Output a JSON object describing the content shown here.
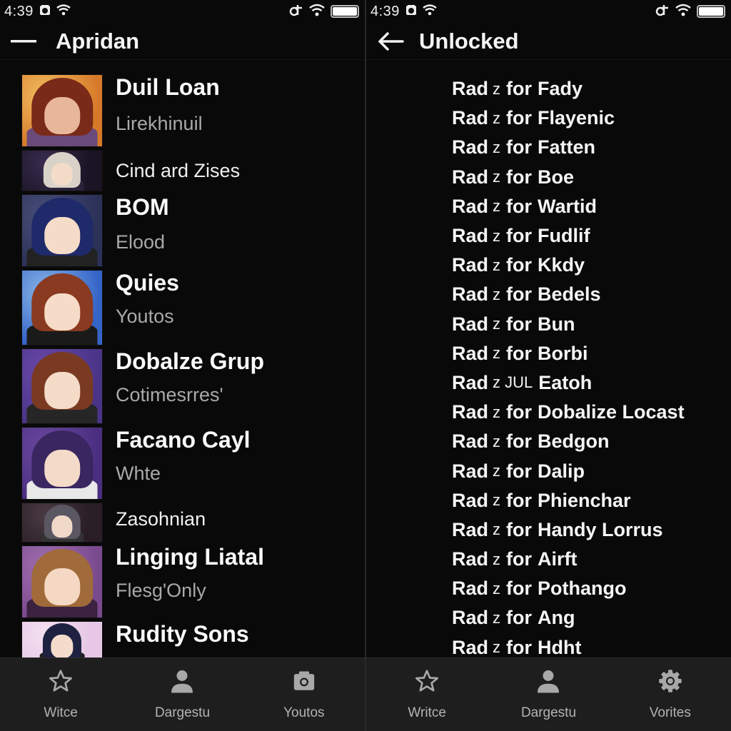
{
  "left_panel": {
    "status_bar": {
      "time": "4:39",
      "icons": [
        "alarm-icon",
        "wifi-icon",
        "vibrate-icon",
        "wifi-signal-icon",
        "battery-icon"
      ]
    },
    "app_bar": {
      "nav_icon": "menu-icon",
      "title": "Apridan"
    },
    "characters": [
      {
        "name": "Duil Loan",
        "subtitle": "Lirekhinuil",
        "palette": {
          "bg": "#d67a2a",
          "bg2": "#f3c060",
          "hair": "#7a2a18",
          "skin": "#e8b79a",
          "body": "#6a4a7a"
        }
      },
      {
        "name": "Cind ard Zises",
        "subtitle": "",
        "palette": {
          "bg": "#1a1424",
          "bg2": "#3a2c50",
          "hair": "#d8d2c8",
          "skin": "#f2dcc8",
          "body": "#2a2238"
        }
      },
      {
        "name": "BOM",
        "subtitle": "Elood",
        "palette": {
          "bg": "#2c3158",
          "bg2": "#4a4f7a",
          "hair": "#1f2a6a",
          "skin": "#f5dcc8",
          "body": "#222"
        }
      },
      {
        "name": "Quies",
        "subtitle": "Youtos",
        "palette": {
          "bg": "#3564c8",
          "bg2": "#8ab8e8",
          "hair": "#8a3a20",
          "skin": "#f6dcc8",
          "body": "#1a1a1a"
        }
      },
      {
        "name": "Dobalze Grup",
        "subtitle": "Cotimesrres'",
        "palette": {
          "bg": "#4a3488",
          "bg2": "#6a4aa8",
          "hair": "#7a3a22",
          "skin": "#f4dcc8",
          "body": "#262626"
        }
      },
      {
        "name": "Facano Cayl",
        "subtitle": "Whte",
        "palette": {
          "bg": "#4a2e80",
          "bg2": "#6a4aa0",
          "hair": "#3a2660",
          "skin": "#f4dac8",
          "body": "#e8e8e8"
        }
      },
      {
        "name": "Zasohnian",
        "subtitle": "",
        "palette": {
          "bg": "#2a1e26",
          "bg2": "#4a3a44",
          "hair": "#5a5662",
          "skin": "#f0d8c8",
          "body": "#333"
        }
      },
      {
        "name": "Linging Liatal",
        "subtitle": "Flesg'Only",
        "palette": {
          "bg": "#7a4a8e",
          "bg2": "#a070b0",
          "hair": "#a06a3a",
          "skin": "#f4d8c4",
          "body": "#3a2240"
        }
      },
      {
        "name": "Rudity Sons",
        "subtitle": "",
        "palette": {
          "bg": "#e6c8e6",
          "bg2": "#f4e0f0",
          "hair": "#1e2240",
          "skin": "#f4dccc",
          "body": "#222"
        }
      }
    ],
    "bottom_nav": [
      {
        "label": "Witce",
        "icon": "star-icon"
      },
      {
        "label": "Dargestu",
        "icon": "person-icon"
      },
      {
        "label": "Youtos",
        "icon": "camera-icon"
      }
    ]
  },
  "right_panel": {
    "status_bar": {
      "time": "4:39",
      "icons": [
        "alarm-icon",
        "wifi-icon",
        "vibrate-icon",
        "wifi-signal-icon",
        "battery-icon"
      ]
    },
    "app_bar": {
      "nav_icon": "back-arrow-icon",
      "title": "Unlocked"
    },
    "unlocked_items": [
      {
        "prefix": "Rad",
        "mid": "z",
        "connector": "for",
        "name": "Fady"
      },
      {
        "prefix": "Rad",
        "mid": "z",
        "connector": "for",
        "name": "Flayenic"
      },
      {
        "prefix": "Rad",
        "mid": "z",
        "connector": "for",
        "name": "Fatten"
      },
      {
        "prefix": "Rad",
        "mid": "z",
        "connector": "for",
        "name": "Boe"
      },
      {
        "prefix": "Rad",
        "mid": "z",
        "connector": "for",
        "name": "Wartid"
      },
      {
        "prefix": "Rad",
        "mid": "z",
        "connector": "for",
        "name": "Fudlif"
      },
      {
        "prefix": "Rad",
        "mid": "z",
        "connector": "for",
        "name": "Kkdy"
      },
      {
        "prefix": "Rad",
        "mid": "z",
        "connector": "for",
        "name": "Bedels"
      },
      {
        "prefix": "Rad",
        "mid": "z",
        "connector": "for",
        "name": "Bun"
      },
      {
        "prefix": "Rad",
        "mid": "z",
        "connector": "for",
        "name": "Borbi"
      },
      {
        "prefix": "Rad",
        "mid": "z JUL",
        "connector": "",
        "name": "Eatoh"
      },
      {
        "prefix": "Rad",
        "mid": "z",
        "connector": "for",
        "name": "Dobalize Locast"
      },
      {
        "prefix": "Rad",
        "mid": "z",
        "connector": "for",
        "name": "Bedgon"
      },
      {
        "prefix": "Rad",
        "mid": "z",
        "connector": "for",
        "name": "Dalip"
      },
      {
        "prefix": "Rad",
        "mid": "z",
        "connector": "for",
        "name": "Phienchar"
      },
      {
        "prefix": "Rad",
        "mid": "z",
        "connector": "for",
        "name": "Handy Lorrus"
      },
      {
        "prefix": "Rad",
        "mid": "z",
        "connector": "for",
        "name": "Airft"
      },
      {
        "prefix": "Rad",
        "mid": "z",
        "connector": "for",
        "name": "Pothango"
      },
      {
        "prefix": "Rad",
        "mid": "z",
        "connector": "for",
        "name": "Ang"
      },
      {
        "prefix": "Rad",
        "mid": "z",
        "connector": "for",
        "name": "Hdht"
      }
    ],
    "bottom_nav": [
      {
        "label": "Writce",
        "icon": "star-icon"
      },
      {
        "label": "Dargestu",
        "icon": "person-icon"
      },
      {
        "label": "Vorites",
        "icon": "gear-icon"
      }
    ]
  }
}
